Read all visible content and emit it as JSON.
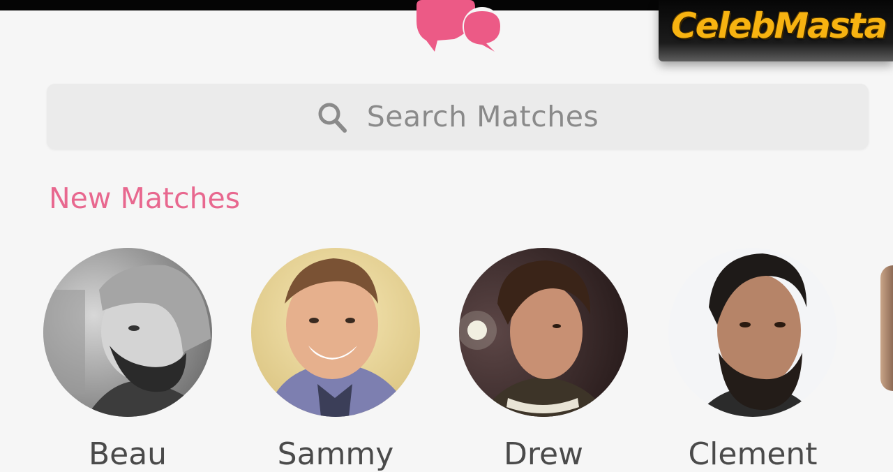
{
  "watermark": {
    "text": "CelebMasta"
  },
  "header": {
    "logo_icon": "chat-bubbles-icon",
    "logo_color": "#ec5a86"
  },
  "search": {
    "icon": "search-icon",
    "placeholder": "Search Matches"
  },
  "new_matches": {
    "title": "New Matches",
    "title_color": "#e8688f",
    "items": [
      {
        "name": "Beau",
        "avatar": "avatar-photo"
      },
      {
        "name": "Sammy",
        "avatar": "avatar-photo"
      },
      {
        "name": "Drew",
        "avatar": "avatar-photo"
      },
      {
        "name": "Clement",
        "avatar": "avatar-photo"
      }
    ]
  }
}
